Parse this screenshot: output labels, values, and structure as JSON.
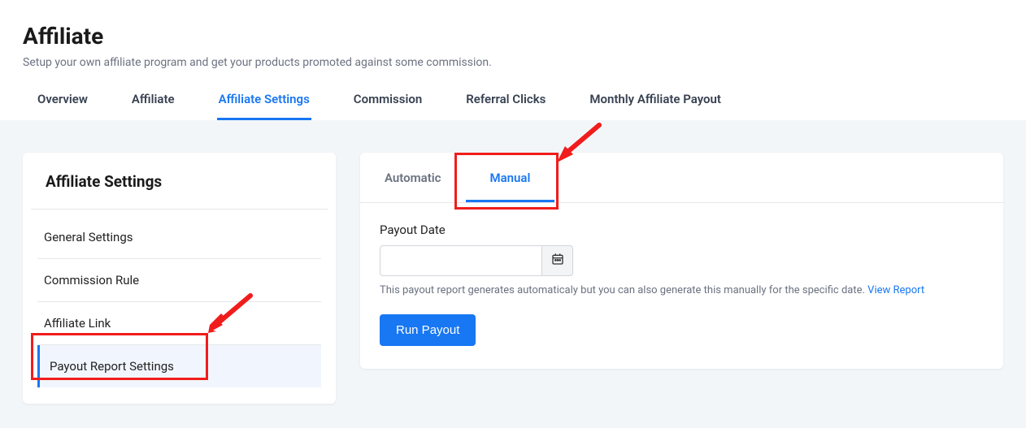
{
  "header": {
    "title": "Affiliate",
    "subtitle": "Setup your own affiliate program and get your products promoted against some commission."
  },
  "top_tabs": [
    {
      "label": "Overview",
      "active": false
    },
    {
      "label": "Affiliate",
      "active": false
    },
    {
      "label": "Affiliate Settings",
      "active": true
    },
    {
      "label": "Commission",
      "active": false
    },
    {
      "label": "Referral Clicks",
      "active": false
    },
    {
      "label": "Monthly Affiliate Payout",
      "active": false
    }
  ],
  "sidebar": {
    "title": "Affiliate Settings",
    "items": [
      {
        "label": "General Settings",
        "active": false
      },
      {
        "label": "Commission Rule",
        "active": false
      },
      {
        "label": "Affiliate Link",
        "active": false
      },
      {
        "label": "Payout Report Settings",
        "active": true
      }
    ]
  },
  "inner_tabs": [
    {
      "label": "Automatic",
      "active": false
    },
    {
      "label": "Manual",
      "active": true
    }
  ],
  "form": {
    "date_label": "Payout Date",
    "date_value": "",
    "help_text": "This payout report generates automaticaly but you can also generate this manually for the specific date. ",
    "help_link": "View Report",
    "run_label": "Run Payout"
  }
}
